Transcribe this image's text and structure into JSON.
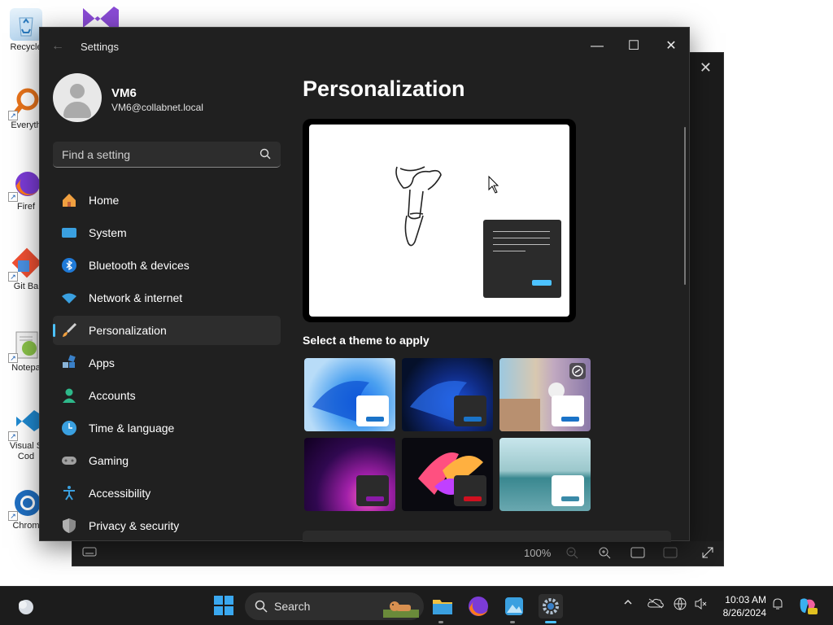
{
  "desktop": {
    "icons": [
      {
        "label": "Recycle",
        "icon": "recycle-bin-icon"
      },
      {
        "label": "Everyth",
        "icon": "everything-search-icon"
      },
      {
        "label": "Firef",
        "icon": "firefox-icon"
      },
      {
        "label": "Git Ba",
        "icon": "git-bash-icon"
      },
      {
        "label": "Notepa",
        "icon": "notepad-plus-icon"
      },
      {
        "label": "Visual S Cod",
        "icon": "vscode-icon"
      },
      {
        "label": "Chrom",
        "icon": "chrome-icon"
      }
    ]
  },
  "background_window": {
    "zoom": "100%"
  },
  "settings": {
    "window_title": "Settings",
    "user": {
      "name": "VM6",
      "email": "VM6@collabnet.local"
    },
    "search": {
      "placeholder": "Find a setting"
    },
    "nav": [
      {
        "label": "Home",
        "icon": "home-icon",
        "active": false
      },
      {
        "label": "System",
        "icon": "system-icon",
        "active": false
      },
      {
        "label": "Bluetooth & devices",
        "icon": "bluetooth-icon",
        "active": false
      },
      {
        "label": "Network & internet",
        "icon": "wifi-icon",
        "active": false
      },
      {
        "label": "Personalization",
        "icon": "brush-icon",
        "active": true
      },
      {
        "label": "Apps",
        "icon": "apps-icon",
        "active": false
      },
      {
        "label": "Accounts",
        "icon": "accounts-icon",
        "active": false
      },
      {
        "label": "Time & language",
        "icon": "clock-globe-icon",
        "active": false
      },
      {
        "label": "Gaming",
        "icon": "gamepad-icon",
        "active": false
      },
      {
        "label": "Accessibility",
        "icon": "accessibility-icon",
        "active": false
      },
      {
        "label": "Privacy & security",
        "icon": "shield-icon",
        "active": false
      }
    ],
    "page_title": "Personalization",
    "themes_label": "Select a theme to apply",
    "themes": [
      {
        "name": "windows-light",
        "bar_color": "#1a73c8"
      },
      {
        "name": "windows-dark",
        "bar_color": "#1a73c8"
      },
      {
        "name": "spotlight",
        "bar_color": "#1a73c8"
      },
      {
        "name": "glow",
        "bar_color": "#8a1aa8"
      },
      {
        "name": "captured-motion",
        "bar_color": "#d01020"
      },
      {
        "name": "flow",
        "bar_color": "#3a8aa8"
      }
    ],
    "accent": "#4cc2ff"
  },
  "taskbar": {
    "search_label": "Search",
    "time": "10:03 AM",
    "date": "8/26/2024"
  }
}
